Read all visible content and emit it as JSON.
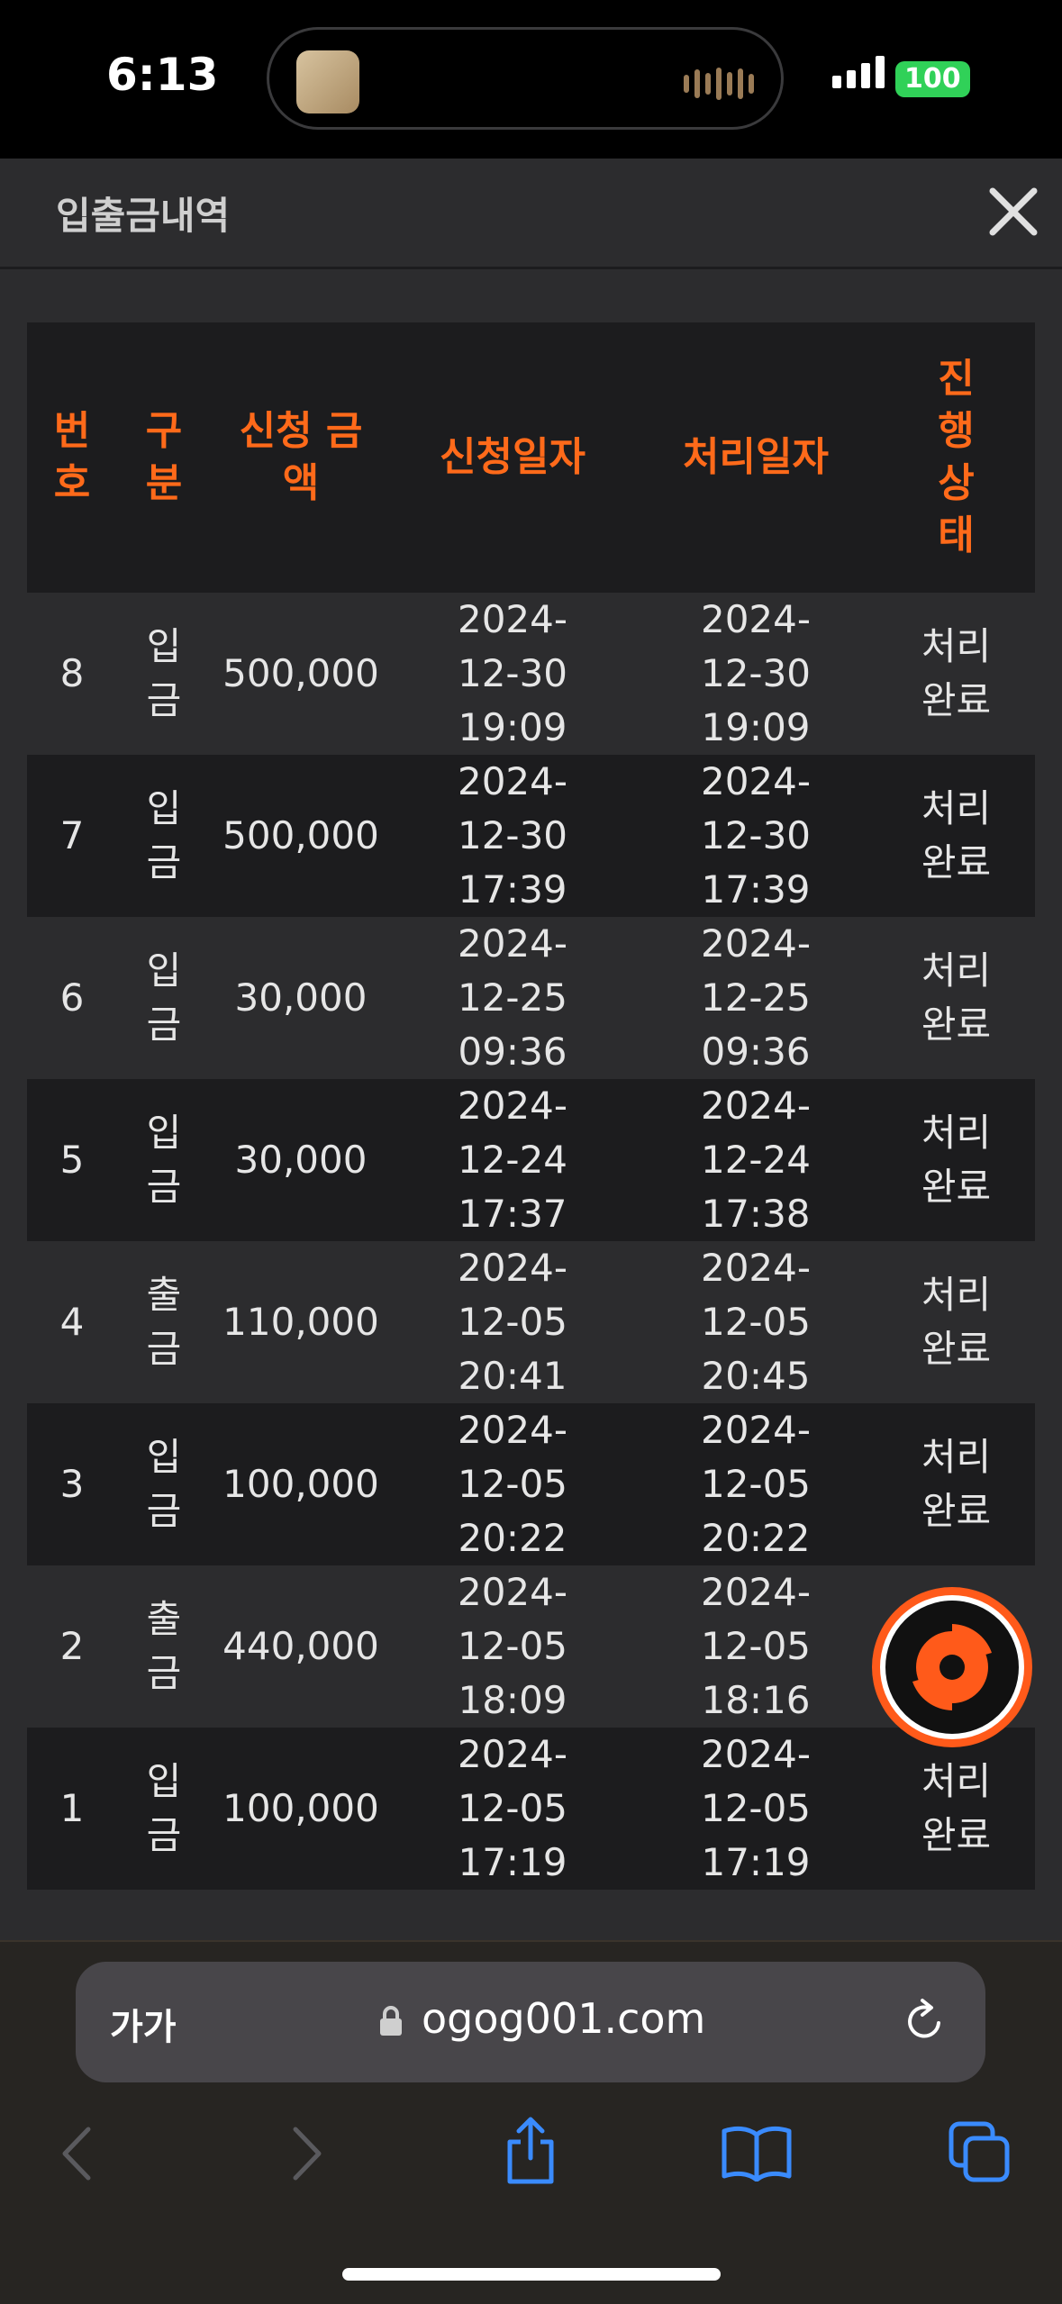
{
  "status_bar": {
    "time": "6:13",
    "battery": "100"
  },
  "header": {
    "title": "입출금내역"
  },
  "table": {
    "headers": [
      "번호",
      "구분",
      "신청 금액",
      "신청일자",
      "처리일자",
      "진행상태"
    ],
    "rows": [
      {
        "no": "8",
        "type": "입금",
        "amount": "500,000",
        "requested": "2024-12-30 19:09",
        "processed": "2024-12-30 19:09",
        "status": "처리완료"
      },
      {
        "no": "7",
        "type": "입금",
        "amount": "500,000",
        "requested": "2024-12-30 17:39",
        "processed": "2024-12-30 17:39",
        "status": "처리완료"
      },
      {
        "no": "6",
        "type": "입금",
        "amount": "30,000",
        "requested": "2024-12-25 09:36",
        "processed": "2024-12-25 09:36",
        "status": "처리완료"
      },
      {
        "no": "5",
        "type": "입금",
        "amount": "30,000",
        "requested": "2024-12-24 17:37",
        "processed": "2024-12-24 17:38",
        "status": "처리완료"
      },
      {
        "no": "4",
        "type": "출금",
        "amount": "110,000",
        "requested": "2024-12-05 20:41",
        "processed": "2024-12-05 20:45",
        "status": "처리완료"
      },
      {
        "no": "3",
        "type": "입금",
        "amount": "100,000",
        "requested": "2024-12-05 20:22",
        "processed": "2024-12-05 20:22",
        "status": "처리완료"
      },
      {
        "no": "2",
        "type": "출금",
        "amount": "440,000",
        "requested": "2024-12-05 18:09",
        "processed": "2024-12-05 18:16",
        "status": ""
      },
      {
        "no": "1",
        "type": "입금",
        "amount": "100,000",
        "requested": "2024-12-05 17:19",
        "processed": "2024-12-05 17:19",
        "status": "처리완료"
      }
    ]
  },
  "browser": {
    "text_size_label": "가가",
    "url": "ogog001.com"
  },
  "colors": {
    "accent": "#ff6a1a",
    "header_bg": "#1c1c1e",
    "page_bg": "#2c2c2e"
  }
}
